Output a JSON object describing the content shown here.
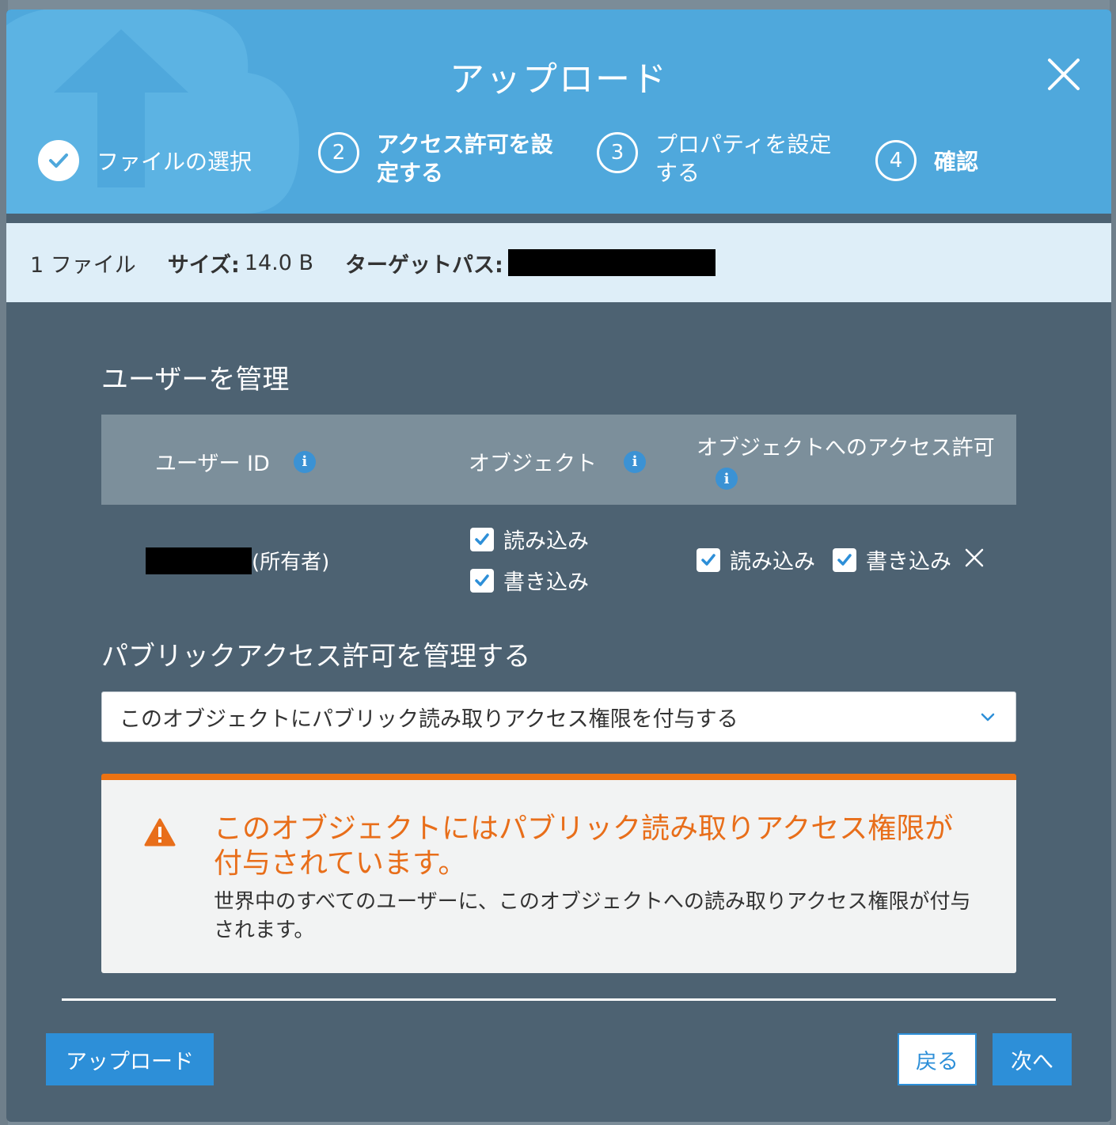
{
  "modal": {
    "title": "アップロード",
    "close_icon": "close-icon"
  },
  "steps": [
    {
      "number": "1",
      "label": "ファイルの選択",
      "status": "completed"
    },
    {
      "number": "2",
      "label_line1": "アクセス許可を設",
      "label_line2": "定する",
      "status": "active"
    },
    {
      "number": "3",
      "label_line1": "プロパティを設定",
      "label_line2": "する",
      "status": "pending"
    },
    {
      "number": "4",
      "label": "確認",
      "status": "pending"
    }
  ],
  "info_bar": {
    "files": "1 ファイル",
    "size_label": "サイズ:",
    "size_value": "14.0 B",
    "target_label": "ターゲットパス:"
  },
  "users_section": {
    "title": "ユーザーを管理",
    "columns": {
      "user_id": "ユーザー ID",
      "object": "オブジェクト",
      "object_permissions": "オブジェクトへのアクセス許可"
    },
    "row": {
      "user_suffix": "(所有者)",
      "object_read": {
        "label": "読み込み",
        "checked": true
      },
      "object_write": {
        "label": "書き込み",
        "checked": true
      },
      "perm_read": {
        "label": "読み込み",
        "checked": true
      },
      "perm_write": {
        "label": "書き込み",
        "checked": true
      }
    }
  },
  "public_section": {
    "title": "パブリックアクセス許可を管理する",
    "selected_option": "このオブジェクトにパブリック読み取りアクセス権限を付与する"
  },
  "alert": {
    "title": "このオブジェクトにはパブリック読み取りアクセス権限が付与されています。",
    "body": "世界中のすべてのユーザーに、このオブジェクトへの読み取りアクセス権限が付与されます。",
    "color": "#ec7211"
  },
  "footer": {
    "upload_button": "アップロード",
    "back_button": "戻る",
    "next_button": "次へ"
  },
  "colors": {
    "header": "#4fa8dc",
    "body": "#4d6272",
    "primary": "#2d8fd8"
  }
}
